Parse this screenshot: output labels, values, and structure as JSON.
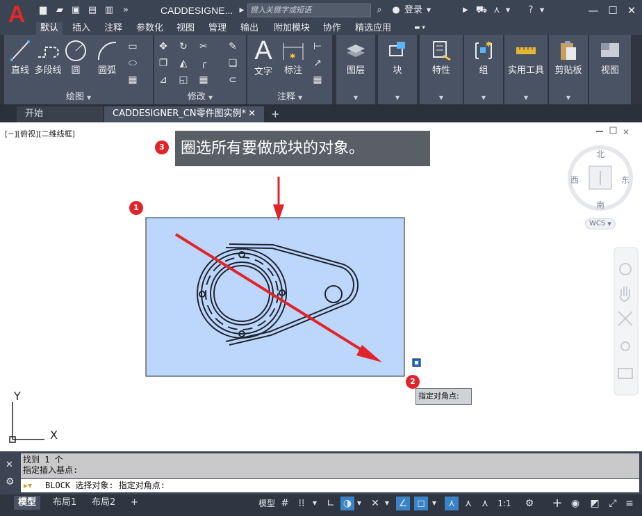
{
  "titlebar": {
    "logo": "A",
    "app_title": "CADDESIGNE...",
    "search_placeholder": "键入关键字或短语",
    "login": "登录"
  },
  "ribbon_tabs": [
    "默认",
    "插入",
    "注释",
    "参数化",
    "视图",
    "管理",
    "输出",
    "附加模块",
    "协作",
    "精选应用"
  ],
  "ribbon": {
    "draw": {
      "line": "直线",
      "polyline": "多段线",
      "circle": "圆",
      "arc": "圆弧",
      "footer": "绘图"
    },
    "modify": {
      "footer": "修改"
    },
    "annotation": {
      "text": "文字",
      "dimension": "标注",
      "footer": "注释"
    },
    "layers": "图层",
    "block": "块",
    "properties": "特性",
    "groups": "组",
    "utilities": "实用工具",
    "clipboard": "剪贴板",
    "view": "视图"
  },
  "doc_tabs": {
    "start": "开始",
    "drawing": "CADDESIGNER_CN零件图实例*"
  },
  "viewport_label": "[−][俯视][二维线框]",
  "compass": {
    "north": "北",
    "south": "南",
    "east": "东",
    "west": "西",
    "wcs": "WCS"
  },
  "annotation_callout": "圈选所有要做成块的对象。",
  "badges": [
    "1",
    "2",
    "3"
  ],
  "tooltip": "指定对角点:",
  "ucs": {
    "x": "X",
    "y": "Y"
  },
  "command": {
    "history_line1": "找到 1 个",
    "history_line2": "指定插入基点:",
    "prompt": "BLOCK 选择对象: 指定对角点:"
  },
  "layout_tabs": [
    "模型",
    "布局1",
    "布局2"
  ],
  "status": {
    "model": "模型",
    "scale": "1:1"
  },
  "colors": {
    "accent_red": "#e0242a",
    "selection_fill": "#bcd7fb",
    "callout_bg": "#5a5f66"
  }
}
